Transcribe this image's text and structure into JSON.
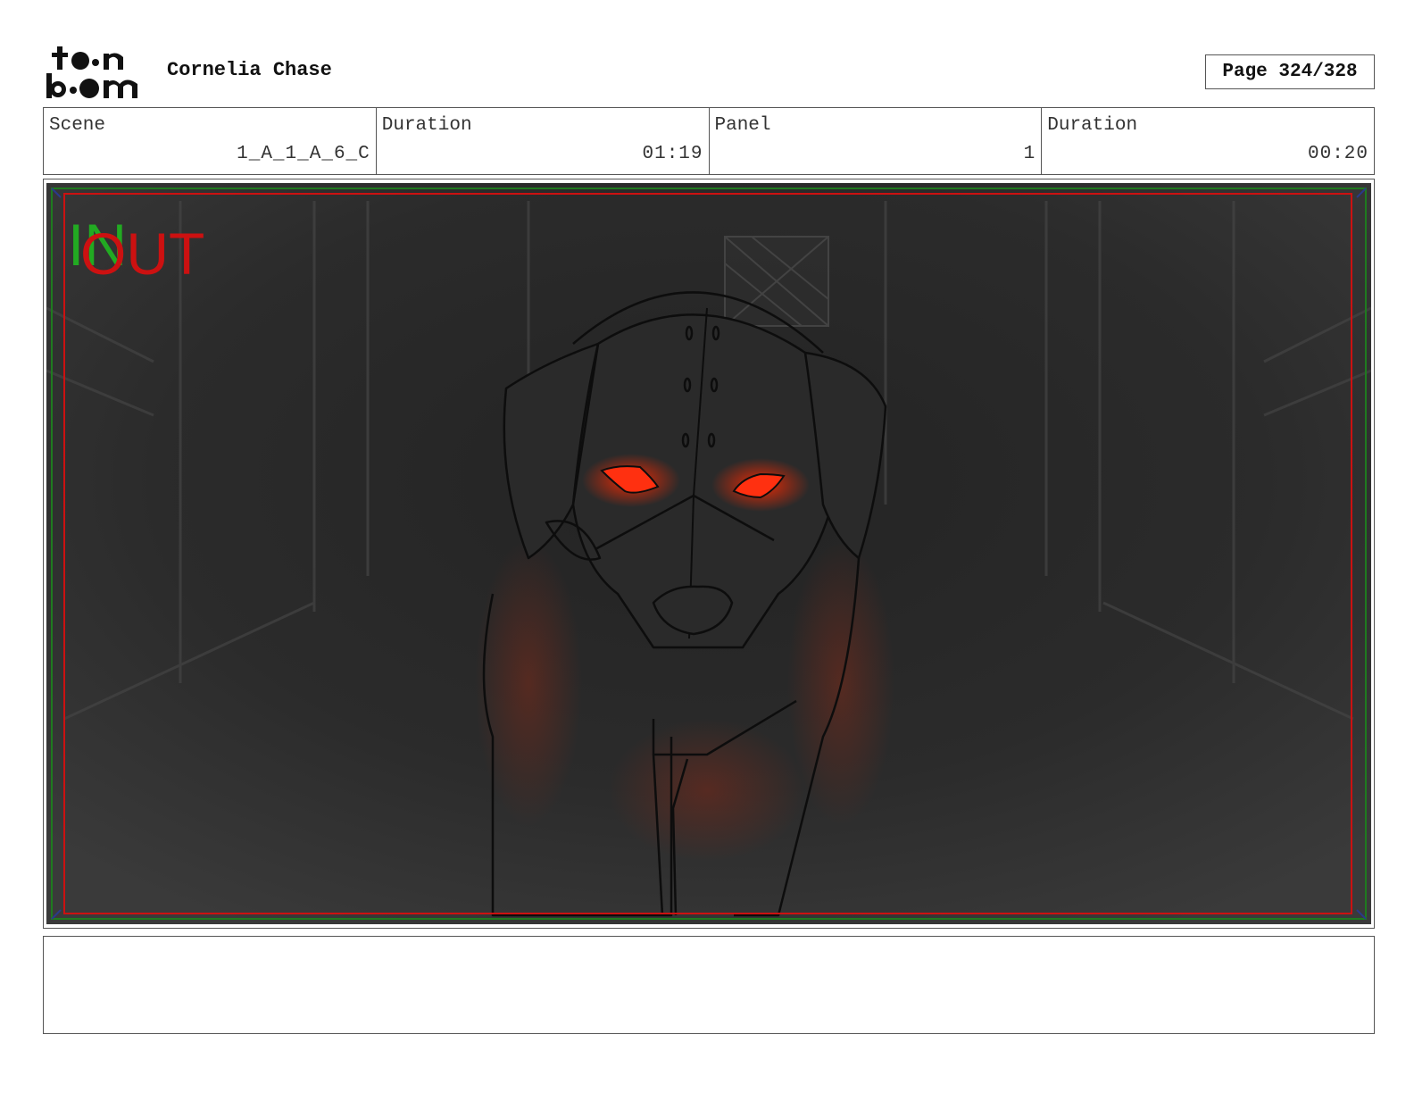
{
  "header": {
    "logo_text": "toon boom",
    "project_title": "Cornelia Chase",
    "page_label": "Page 324/328"
  },
  "info": [
    {
      "label": "Scene",
      "value": "1_A_1_A_6_C"
    },
    {
      "label": "Duration",
      "value": "01:19"
    },
    {
      "label": "Panel",
      "value": "1"
    },
    {
      "label": "Duration",
      "value": "00:20"
    }
  ],
  "panel": {
    "in_label": "IN",
    "out_label": "OUT",
    "in_color": "#22aa22",
    "out_color": "#cc1111",
    "eye_color": "#ff3010",
    "safe_frame_color": "#cc1111",
    "field_frame_color": "#1f7a1f"
  },
  "notes": {
    "text": ""
  }
}
